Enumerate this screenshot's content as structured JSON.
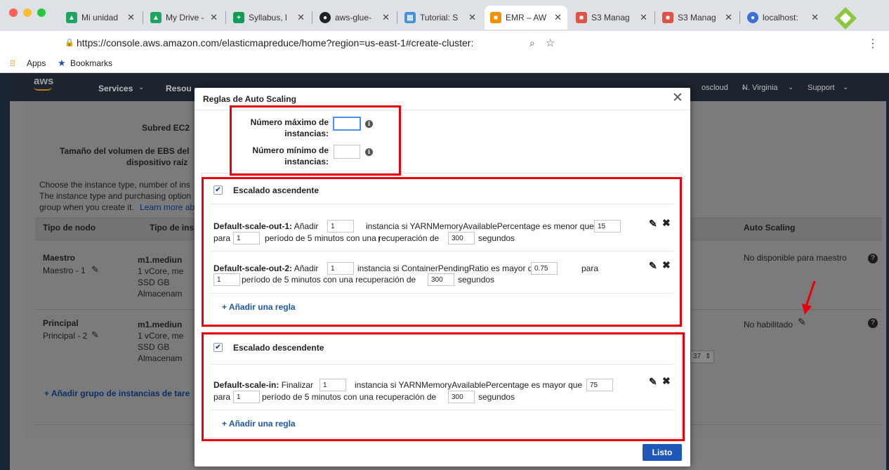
{
  "browser": {
    "tabs": [
      {
        "label": "Mi unidad",
        "icon": "google-drive-icon",
        "color": "#1fa463"
      },
      {
        "label": "My Drive -",
        "icon": "google-drive-icon",
        "color": "#1fa463"
      },
      {
        "label": "Syllabus, l",
        "icon": "sheets-icon",
        "color": "#0f9d58"
      },
      {
        "label": "aws-glue-",
        "icon": "github-icon",
        "color": "#222222"
      },
      {
        "label": "Tutorial: S",
        "icon": "aws-docs-icon",
        "color": "#4a90d9"
      },
      {
        "label": "EMR – AW",
        "icon": "aws-emr-icon",
        "color": "#f29100"
      },
      {
        "label": "S3 Manag",
        "icon": "aws-s3-icon",
        "color": "#e05243"
      },
      {
        "label": "S3 Manag",
        "icon": "aws-s3-icon",
        "color": "#e05243"
      },
      {
        "label": "localhost:",
        "icon": "localhost-icon",
        "color": "#3b6fd6"
      }
    ],
    "url": "https://console.aws.amazon.com/elasticmapreduce/home?region=us-east-1#create-cluster:",
    "bookmarks": {
      "apps": "Apps",
      "bookmarks": "Bookmarks"
    }
  },
  "aws_nav": {
    "logo": "aws",
    "services": "Services",
    "resources": "Resou",
    "account": "oscloud",
    "region": "N. Virginia",
    "support": "Support"
  },
  "background": {
    "subnet_label": "Subred EC2",
    "ebs_label_1": "Tamaño del volumen de EBS del",
    "ebs_label_2": "dispositivo raíz",
    "intro_1": "Choose the instance type, number of ins",
    "intro_2": "The instance type and purchasing option",
    "intro_3": "group when you create it.",
    "learn_more": "Learn more ab",
    "col_node_type": "Tipo de nodo",
    "col_instance_type": "Tipo de ins",
    "col_auto_scaling": "Auto Scaling",
    "master": {
      "name": "Maestro",
      "count": "Maestro - 1",
      "type": "m1.mediun",
      "spec1": "1 vCore, me",
      "spec2": "SSD GB",
      "spec3": "Almacenam",
      "auto_scaling": "No disponible para maestro"
    },
    "core": {
      "name": "Principal",
      "count": "Principal - 2",
      "type": "m1.mediun",
      "spec1": "1 vCore, me",
      "spec2": "SSD GB",
      "spec3": "Almacenam",
      "auto_scaling": "No habilitado",
      "stepper": "37"
    },
    "add_task_group": "+ Añadir grupo de instancias de tare"
  },
  "modal": {
    "title": "Reglas de Auto Scaling",
    "max_label": "Número máximo de instancias:",
    "max_value": "",
    "min_label": "Número mínimo de instancias:",
    "min_value": "",
    "scale_out": {
      "heading": "Escalado ascendente",
      "rule1": {
        "name": "Default-scale-out-1:",
        "t1": "Añadir",
        "count": "1",
        "t2": "instancia si YARNMemoryAvailablePercentage es menor que",
        "threshold": "15",
        "t3": "para",
        "periods": "1",
        "t4": "período de 5 minutos con una recuperación de",
        "cooldown": "300",
        "t5": "segundos"
      },
      "rule2": {
        "name": "Default-scale-out-2:",
        "t1": "Añadir",
        "count": "1",
        "t2": "instancia si ContainerPendingRatio es mayor que",
        "threshold": "0.75",
        "t3": "para",
        "periods": "1",
        "t4": "período de 5 minutos con una recuperación de",
        "cooldown": "300",
        "t5": "segundos"
      },
      "add_rule": "+ Añadir una regla"
    },
    "scale_in": {
      "heading": "Escalado descendente",
      "rule1": {
        "name": "Default-scale-in:",
        "t1": "Finalizar",
        "count": "1",
        "t2": "instancia si YARNMemoryAvailablePercentage es mayor que",
        "threshold": "75",
        "t3": "para",
        "periods": "1",
        "t4": "período de 5 minutos con una recuperación de",
        "cooldown": "300",
        "t5": "segundos"
      },
      "add_rule": "+ Añadir una regla"
    },
    "done_button": "Listo"
  },
  "colors": {
    "highlight": "#e8000b",
    "primary_button": "#1f58b8",
    "link": "#1f56a8"
  }
}
